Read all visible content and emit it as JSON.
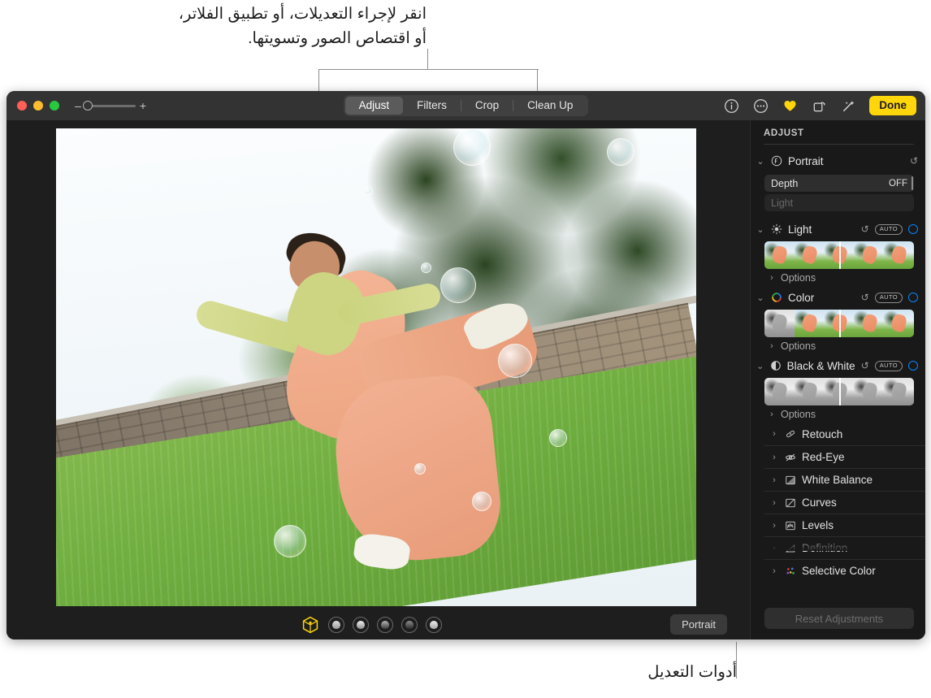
{
  "callouts": {
    "top": "انقر لإجراء التعديلات، أو تطبيق الفلاتر،\nأو اقتصاص الصور وتسويتها.",
    "bottom": "أدوات التعديل"
  },
  "toolbar": {
    "zoom_out_label": "–",
    "zoom_in_label": "+",
    "tabs": [
      {
        "label": "Adjust",
        "active": true
      },
      {
        "label": "Filters",
        "active": false
      },
      {
        "label": "Crop",
        "active": false
      },
      {
        "label": "Clean Up",
        "active": false
      }
    ],
    "icons": [
      "info-icon",
      "more-options-icon",
      "favorite-heart-icon",
      "rotate-icon",
      "enhance-wand-icon"
    ],
    "done_label": "Done"
  },
  "panel": {
    "title": "ADJUST",
    "sections": [
      {
        "label": "Portrait",
        "icon": "portrait-f-icon",
        "expanded": true,
        "reset": "↺",
        "sliders": [
          {
            "name": "Depth",
            "value": "OFF",
            "enabled": true
          },
          {
            "name": "Light",
            "value": "",
            "enabled": false
          }
        ]
      },
      {
        "label": "Light",
        "icon": "brightness-sun-icon",
        "expanded": true,
        "reset": "↺",
        "auto": "AUTO",
        "filmstrip": "color",
        "options_label": "Options"
      },
      {
        "label": "Color",
        "icon": "color-wheel-icon",
        "expanded": true,
        "reset": "↺",
        "auto": "AUTO",
        "filmstrip": "color",
        "options_label": "Options"
      },
      {
        "label": "Black & White",
        "icon": "contrast-circle-icon",
        "expanded": true,
        "reset": "↺",
        "auto": "AUTO",
        "filmstrip": "gray",
        "options_label": "Options"
      }
    ],
    "collapsed_rows": [
      {
        "label": "Retouch",
        "icon": "retouch-bandage-icon"
      },
      {
        "label": "Red-Eye",
        "icon": "red-eye-icon"
      },
      {
        "label": "White Balance",
        "icon": "white-balance-icon"
      },
      {
        "label": "Curves",
        "icon": "curves-icon"
      },
      {
        "label": "Levels",
        "icon": "levels-icon"
      },
      {
        "label": "Definition",
        "icon": "definition-icon"
      },
      {
        "label": "Selective Color",
        "icon": "selective-color-icon"
      }
    ],
    "reset_button": "Reset Adjustments"
  },
  "bottom_bar": {
    "lighting_modes": [
      "natural-light-cube-icon",
      "studio-light-icon",
      "contour-light-icon",
      "stage-light-icon",
      "stage-light-mono-icon",
      "high-key-light-mono-icon"
    ],
    "mode_badge": "Portrait"
  },
  "colors": {
    "accent_yellow": "#ffd60a",
    "accent_blue": "#0a84ff",
    "toolbar_bg": "#333333",
    "window_bg": "#1e1e1e",
    "panel_bg": "#191919"
  }
}
